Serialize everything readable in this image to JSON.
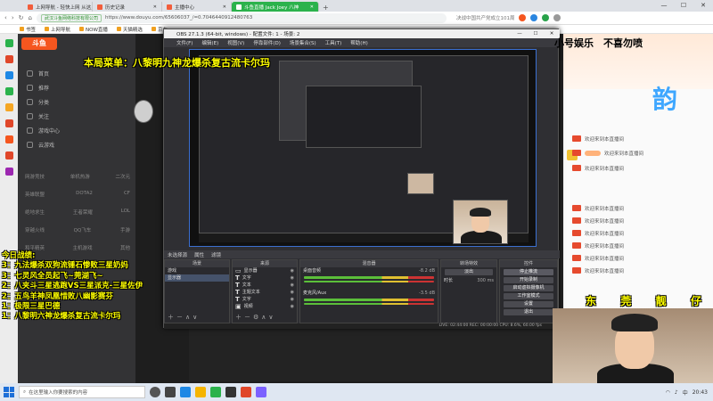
{
  "browser": {
    "tabs": [
      {
        "label": "上网导航 - 轻快上网 从这里开始"
      },
      {
        "label": "历史记录"
      },
      {
        "label": "主播中心"
      },
      {
        "label": "斗鱼直播 Jack Joey 八神"
      }
    ],
    "address": {
      "site_badge": "武汉斗鱼网络科技有限公司",
      "url": "https://www.douyu.com/65606037_/=0.7046440912480763",
      "search_suggest": "决战中国共产党成立101周"
    },
    "bookmarks": [
      {
        "label": "书签"
      },
      {
        "label": "上网导航"
      },
      {
        "label": "NOW直播"
      },
      {
        "label": "天猫精选"
      },
      {
        "label": "京东"
      }
    ]
  },
  "douyu": {
    "logo": "斗鱼",
    "nav": [
      {
        "label": "首页"
      },
      {
        "label": "推荐"
      },
      {
        "label": "分类"
      },
      {
        "label": "关注"
      },
      {
        "label": "游戏中心"
      },
      {
        "label": "云游戏"
      }
    ],
    "categories": [
      {
        "left": "网游竞技",
        "mid": "单机热游",
        "right": "二次元"
      },
      {
        "left": "英雄联盟",
        "mid": "DOTA2",
        "right": "CF"
      },
      {
        "left": "绝地求生",
        "mid": "王者荣耀",
        "right": "LOL"
      },
      {
        "left": "穿越火线",
        "mid": "QQ飞车",
        "right": "手游"
      },
      {
        "left": "和平精英",
        "mid": "主机游戏",
        "right": "其他"
      }
    ],
    "chat_rows": [
      {
        "text": "欢迎来到本直播间"
      },
      {
        "text": "欢迎来到本直播间"
      },
      {
        "text": "欢迎来到本直播间"
      },
      {
        "text": "欢迎来到本直播间"
      },
      {
        "text": "欢迎来到本直播间"
      },
      {
        "text": "欢迎来到本直播间"
      },
      {
        "text": "欢迎来到本直播间"
      },
      {
        "text": "欢迎来到本直播间"
      },
      {
        "text": "欢迎来到本直播间"
      }
    ],
    "rp_big_glyph": "韵"
  },
  "obs": {
    "title": "OBS 27.1.3 (64-bit, windows) - 配置文件: 1 - 场景: 2",
    "menu": [
      {
        "label": "文件(F)"
      },
      {
        "label": "编辑(E)"
      },
      {
        "label": "视图(V)"
      },
      {
        "label": "停靠部件(D)"
      },
      {
        "label": "场景集合(S)"
      },
      {
        "label": "工具(T)"
      },
      {
        "label": "帮助(H)"
      }
    ],
    "scene_bar": {
      "label": "未选择源",
      "props": "属性",
      "filters": "滤镜"
    },
    "docks": {
      "scenes": {
        "title": "场景",
        "items": [
          {
            "label": "游戏"
          },
          {
            "label": "显示器"
          }
        ]
      },
      "sources": {
        "title": "来源",
        "items": [
          {
            "label": "显示器"
          },
          {
            "label": "文字"
          },
          {
            "label": "文本"
          },
          {
            "label": "主题文本"
          },
          {
            "label": "文字"
          },
          {
            "label": "视频"
          }
        ]
      },
      "mixer": {
        "title": "混音器",
        "channels": [
          {
            "label": "桌面音频",
            "db": "-8.2 dB"
          },
          {
            "label": "麦克风/Aux",
            "db": "-3.5 dB"
          }
        ]
      },
      "transitions": {
        "title": "转场特效",
        "mode": "淡出",
        "duration_label": "时长",
        "duration": "300 ms"
      },
      "controls": {
        "title": "控件",
        "buttons": [
          {
            "label": "停止推流"
          },
          {
            "label": "开始录制"
          },
          {
            "label": "启动虚拟摄像机"
          },
          {
            "label": "工作室模式"
          },
          {
            "label": "设置"
          },
          {
            "label": "退出"
          }
        ]
      }
    },
    "status": "LIVE: 02:44:00  REC: 00:00:00  CPU: 8.6%, 60.00 fps"
  },
  "overlays": {
    "menu_caption": "本局菜单：八黎明九神龙爆杀复古流卡尔玛",
    "top_caption": "小号娱乐　不喜勿喷",
    "battle_title": "今日战绩:",
    "battle_lines": [
      {
        "text": "3：九法爆杀双狗流锤石惨败三星奶妈"
      },
      {
        "text": "3：七灵风全员起飞~莞湖飞~"
      },
      {
        "text": "2：八夹斗三星逃跑VS三星派克-三星佐伊"
      },
      {
        "text": "2：五鸟羊神凤凰惜败八幽影赛芬"
      },
      {
        "text": "1：极限三星巴德"
      },
      {
        "text": "1：八黎明六神龙爆杀复古流卡尔玛"
      }
    ],
    "dongguan": [
      "东",
      "莞",
      "靓",
      "仔"
    ]
  },
  "taskbar": {
    "search_placeholder": "在这里输入你要搜索的内容",
    "tray_time": "20:43",
    "tray_lang": "中"
  },
  "colors": {
    "accent": "#f5561f",
    "active_tab": "#2bb24c",
    "overlay_text": "#ffff00"
  }
}
